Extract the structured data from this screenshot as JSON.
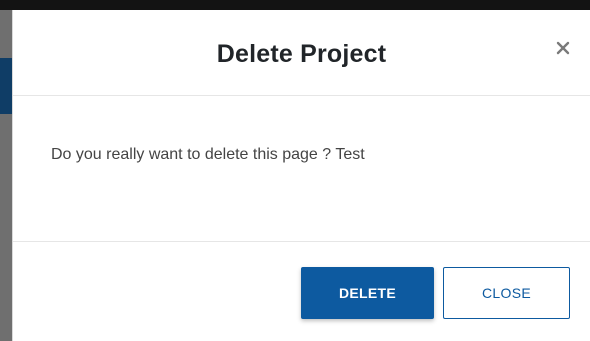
{
  "dialog": {
    "title": "Delete Project",
    "message": "Do you really want to delete this page ? Test",
    "close_icon": "close-icon",
    "delete_label": "DELETE",
    "close_label": "CLOSE"
  },
  "colors": {
    "primary": "#0d5aa0",
    "title_text": "#212529",
    "body_text": "#444444",
    "divider": "#e6e6e6"
  }
}
